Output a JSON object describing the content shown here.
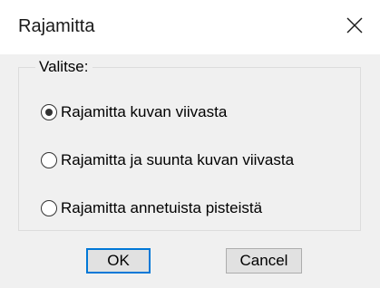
{
  "dialog": {
    "title": "Rajamitta",
    "close_icon": "close-icon"
  },
  "group": {
    "label": "Valitse:",
    "options": [
      {
        "label": "Rajamitta kuvan viivasta",
        "checked": true
      },
      {
        "label": "Rajamitta ja suunta kuvan viivasta",
        "checked": false
      },
      {
        "label": "Rajamitta annetuista pisteistä",
        "checked": false
      }
    ]
  },
  "buttons": {
    "ok_label": "OK",
    "cancel_label": "Cancel"
  },
  "colors": {
    "client_background": "#f0f0f0",
    "default_button_border": "#0078d7",
    "button_face": "#e1e1e1"
  }
}
